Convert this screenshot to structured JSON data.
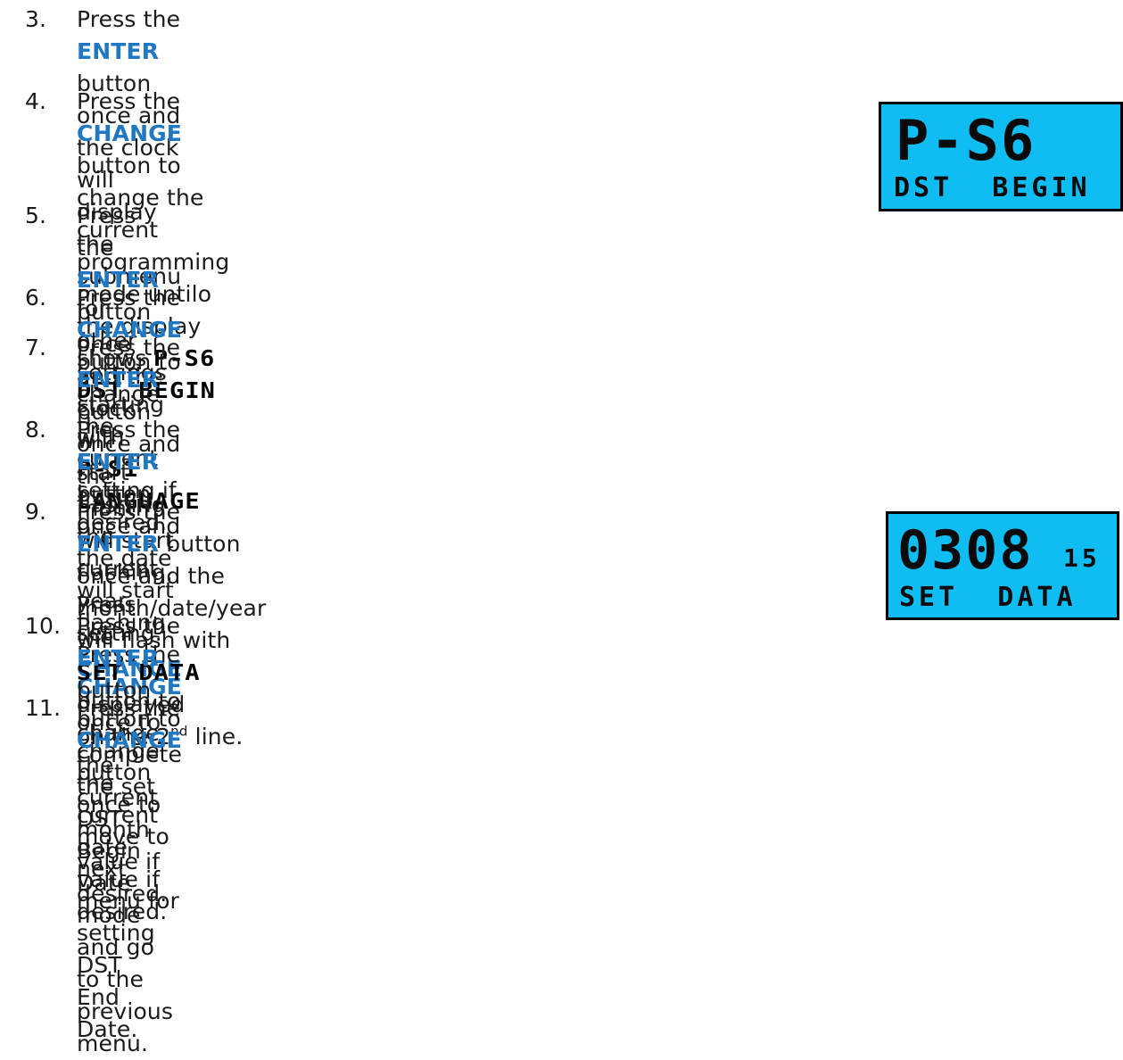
{
  "steps": [
    {
      "num": "3.",
      "lines": [
        [
          "Press the ",
          {
            "kw": "ENTER"
          },
          " button once and the clock will display the submenu for"
        ],
        [
          "other settings starting with ",
          {
            "lcd": "P-S1 LANGUAGE"
          },
          "."
        ]
      ]
    },
    {
      "num": "4.",
      "lines": [
        [
          "Press the ",
          {
            "kw": "CHANGE"
          },
          " button to change the current"
        ],
        [
          "programming mode untilo the display shows ",
          {
            "lcd": "P-S6"
          }
        ],
        [
          {
            "lcd": "DST BEGIN"
          },
          "."
        ]
      ]
    },
    {
      "num": "5.",
      "lines": [
        [
          "Press the ",
          {
            "kw": "ENTER"
          },
          " button once and the clock will start flashing the"
        ],
        [
          "current year setting."
        ]
      ]
    },
    {
      "num": "6.",
      "lines": [
        [
          "Press the ",
          {
            "kw": "CHANGE"
          },
          " button to change the current setting if desired."
        ]
      ]
    },
    {
      "num": "7.",
      "lines": [
        [
          "Press the ",
          {
            "kw": "ENTER"
          },
          " button once and the month will start flashing. Press"
        ],
        [
          "the ",
          {
            "kw": "CHANGE"
          },
          " button to change the current month value if desired."
        ]
      ]
    },
    {
      "num": "8.",
      "lines": [
        [
          "Press the ",
          {
            "kw": "ENTER"
          },
          " button once and the date will start flashing. Press the"
        ],
        [
          {
            "kw": "CHANGE"
          },
          " button to change the current date value if desired."
        ]
      ]
    },
    {
      "num": "9.",
      "lines": [
        [
          "Press the ",
          {
            "kw": "ENTER"
          },
          " button once and the"
        ],
        [
          "month/date/year will flash with ",
          {
            "lcd": "SET DATA"
          },
          " displayed"
        ],
        [
          "on the 2",
          {
            "sup": "nd"
          },
          " line."
        ]
      ]
    },
    {
      "num": "10.",
      "lines": [
        [
          "Press the ",
          {
            "kw": "ENTER"
          },
          " button once to complete the set"
        ],
        [
          "DST Begin Date mode and go to the previous menu."
        ]
      ]
    },
    {
      "num": "11.",
      "lines": [
        [
          "Press the ",
          {
            "kw": "CHANGE"
          },
          " button once to move to next menu for setting DST"
        ],
        [
          "End Date."
        ]
      ]
    }
  ],
  "lcd_displays": [
    {
      "line1": "P-S6",
      "line1_small": "",
      "line2": "DST  BEGIN"
    },
    {
      "line1": "0308",
      "line1_small": "15",
      "line2": "SET  DATA"
    }
  ],
  "colors": {
    "keyword": "#1f78c1",
    "lcd_background": "#0fbdf2",
    "lcd_border": "#000000"
  }
}
